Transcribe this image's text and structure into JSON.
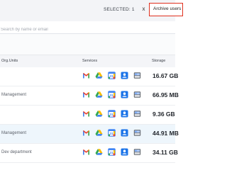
{
  "header": {
    "selected_label": "SELECTED: 1",
    "close_glyph": "x",
    "archive_button": "Archive users"
  },
  "search": {
    "placeholder": "Search by name or email"
  },
  "table": {
    "columns": {
      "org_units": "Org.Units",
      "services": "Services",
      "storage": "Storage"
    },
    "service_icons": [
      "gmail-icon",
      "google-drive-icon",
      "google-calendar-icon",
      "google-contacts-icon",
      "google-shared-drives-icon"
    ],
    "rows": [
      {
        "org_unit": "",
        "storage": "16.67 GB",
        "highlighted": false
      },
      {
        "org_unit": "Management",
        "storage": "66.95 MB",
        "highlighted": false
      },
      {
        "org_unit": "",
        "storage": "9.36 GB",
        "highlighted": false
      },
      {
        "org_unit": "Management",
        "storage": "44.91 MB",
        "highlighted": true
      },
      {
        "org_unit": "Dev department",
        "storage": "34.11 GB",
        "highlighted": false
      }
    ]
  },
  "colors": {
    "archive_border": "#e0301e",
    "highlight_row": "#eef6fc",
    "calendar_blue": "#4285f4",
    "contacts_blue": "#1a73e8"
  }
}
